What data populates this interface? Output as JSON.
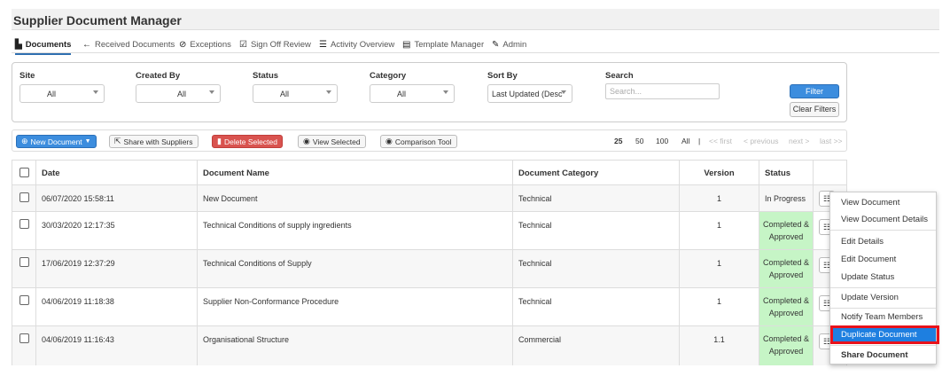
{
  "app_title": "Supplier Document Manager",
  "nav": {
    "tabs": [
      {
        "label": "Documents",
        "icon": "file-icon"
      },
      {
        "label": "Received Documents",
        "icon": "arrow-left-icon"
      },
      {
        "label": "Exceptions",
        "icon": "circle-exclamation-icon"
      },
      {
        "label": "Sign Off Review",
        "icon": "check-square-icon"
      },
      {
        "label": "Activity Overview",
        "icon": "list-icon"
      },
      {
        "label": "Template Manager",
        "icon": "list-alt-icon"
      },
      {
        "label": "Admin",
        "icon": "wrench-icon"
      }
    ]
  },
  "filters": {
    "site": {
      "label": "Site",
      "value": "All"
    },
    "created_by": {
      "label": "Created By",
      "value": "All"
    },
    "status": {
      "label": "Status",
      "value": "All"
    },
    "category": {
      "label": "Category",
      "value": "All"
    },
    "sort_by": {
      "label": "Sort By",
      "value": "Last Updated (Desc"
    },
    "search": {
      "label": "Search",
      "placeholder": "Search..."
    },
    "filter_button": "Filter",
    "clear_button": "Clear Filters"
  },
  "toolbar": {
    "new_document": "New Document",
    "share": "Share with Suppliers",
    "delete": "Delete Selected",
    "view_selected": "View Selected",
    "comparison": "Comparison Tool",
    "page_sizes": [
      "25",
      "50",
      "100",
      "All",
      "|"
    ],
    "paging": [
      "<< first",
      "< previous",
      "next >",
      "last >>"
    ]
  },
  "table": {
    "headers": [
      "Date",
      "Document Name",
      "Document Category",
      "Version",
      "Status"
    ],
    "rows": [
      {
        "date": "06/07/2020 15:58:11",
        "name": "New Document",
        "category": "Technical",
        "version": "1",
        "status": "In Progress"
      },
      {
        "date": "30/03/2020 12:17:35",
        "name": "Technical Conditions of supply ingredients",
        "category": "Technical",
        "version": "1",
        "status": "Completed & Approved"
      },
      {
        "date": "17/06/2019 12:37:29",
        "name": "Technical Conditions of Supply",
        "category": "Technical",
        "version": "1",
        "status": "Completed & Approved"
      },
      {
        "date": "04/06/2019 11:18:38",
        "name": "Supplier Non-Conformance Procedure",
        "category": "Technical",
        "version": "1",
        "status": "Completed & Approved"
      },
      {
        "date": "04/06/2019 11:16:43",
        "name": "Organisational Structure",
        "category": "Commercial",
        "version": "1.1",
        "status": "Completed & Approved"
      }
    ]
  },
  "context_menu": {
    "items": [
      "View Document",
      "View Document Details",
      "Edit Details",
      "Edit Document",
      "Update Status",
      "Update Version",
      "Notify Team Members",
      "Duplicate Document",
      "Share Document"
    ],
    "highlighted": "Duplicate Document"
  },
  "colors": {
    "primary": "#3c8dde",
    "danger": "#d9534f",
    "status_completed": "#c6f5c6",
    "highlight": "#e8121b"
  }
}
